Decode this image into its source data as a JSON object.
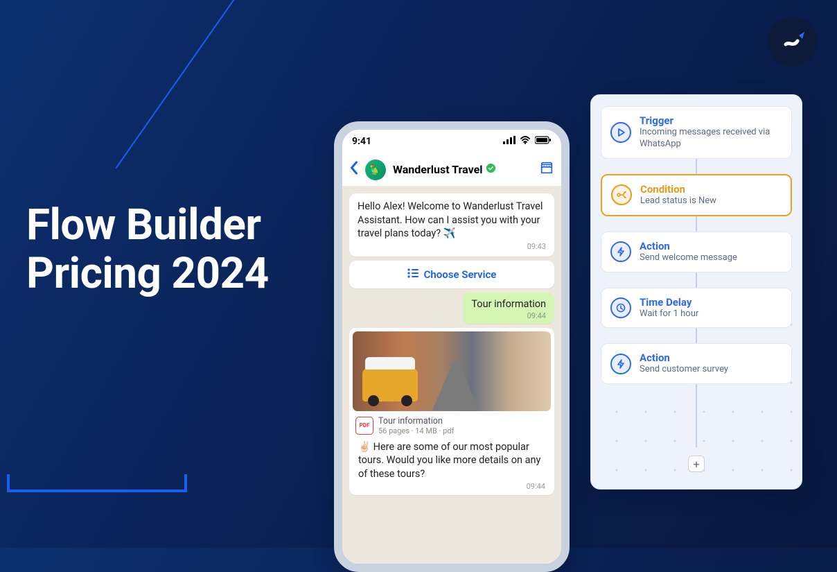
{
  "headline": {
    "line1": "Flow Builder",
    "line2": "Pricing 2024"
  },
  "phone": {
    "time": "9:41",
    "header": {
      "title": "Wanderlust Travel"
    },
    "messages": {
      "welcome": {
        "text": "Hello Alex! Welcome to Wanderlust Travel Assistant. How can I assist you with your travel plans today? ✈️",
        "time": "09:43"
      },
      "choose_button": "Choose Service",
      "user_reply": {
        "text": "Tour information",
        "time": "09:44"
      },
      "media": {
        "file_name": "Tour information",
        "file_meta": "56 pages · 14 MB · pdf",
        "pdf_label": "PDF",
        "text": "✌🏻 Here are some of our most popular tours. Would you like more details on any of these tours?",
        "time": "09:44"
      }
    }
  },
  "flow": {
    "steps": [
      {
        "title": "Trigger",
        "desc": "Incoming messages received via WhatsApp"
      },
      {
        "title": "Condition",
        "desc": "Lead status is New"
      },
      {
        "title": "Action",
        "desc": "Send welcome message"
      },
      {
        "title": "Time Delay",
        "desc": "Wait for 1 hour"
      },
      {
        "title": "Action",
        "desc": "Send customer survey"
      }
    ],
    "add_label": "+"
  }
}
